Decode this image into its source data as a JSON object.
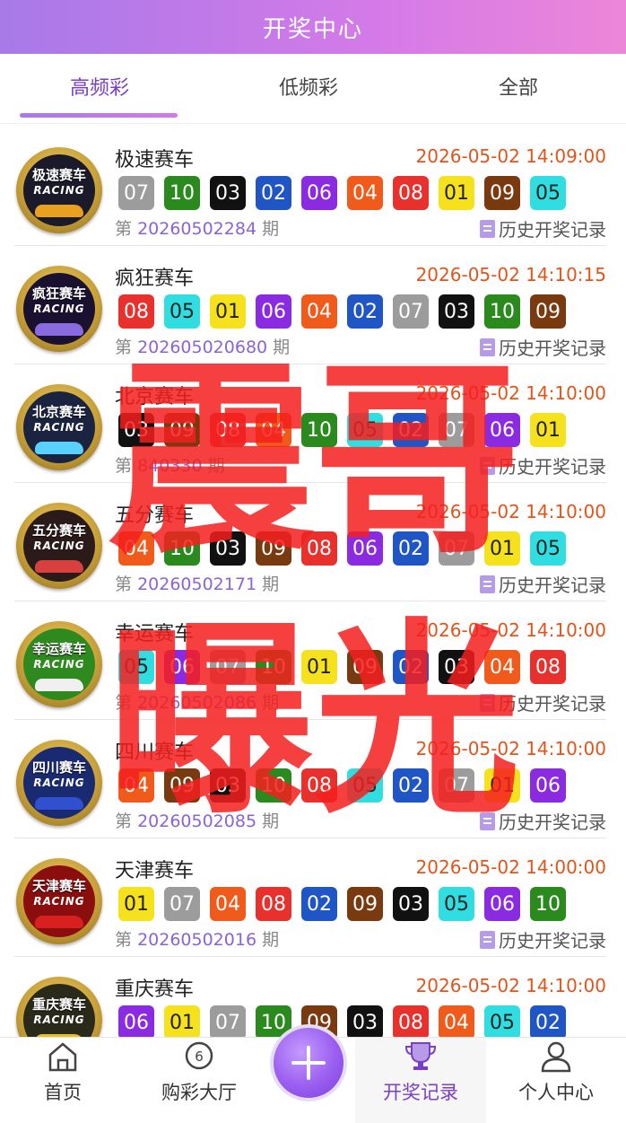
{
  "header": {
    "title": "开奖中心"
  },
  "tabs": [
    {
      "label": "高频彩",
      "active": true
    },
    {
      "label": "低频彩",
      "active": false
    },
    {
      "label": "全部",
      "active": false
    }
  ],
  "issue_prefix": "第",
  "issue_suffix": "期",
  "history_label": "历史开奖记录",
  "logo_sub": "RACING",
  "lotteries": [
    {
      "name": "极速赛车",
      "logo_name": "极速赛车",
      "time": "2026-05-02 14:09:00",
      "issue": "20260502284",
      "balls": [
        "07",
        "10",
        "03",
        "02",
        "06",
        "04",
        "08",
        "01",
        "09",
        "05"
      ]
    },
    {
      "name": "疯狂赛车",
      "logo_name": "疯狂赛车",
      "time": "2026-05-02 14:10:15",
      "issue": "202605020680",
      "balls": [
        "08",
        "05",
        "01",
        "06",
        "04",
        "02",
        "07",
        "03",
        "10",
        "09"
      ]
    },
    {
      "name": "北京赛车",
      "logo_name": "北京赛车",
      "time": "2026-05-02 14:10:00",
      "issue": "840330",
      "balls": [
        "03",
        "09",
        "08",
        "04",
        "10",
        "05",
        "02",
        "07",
        "06",
        "01"
      ]
    },
    {
      "name": "五分赛车",
      "logo_name": "五分赛车",
      "time": "2026-05-02 14:10:00",
      "issue": "20260502171",
      "balls": [
        "04",
        "10",
        "03",
        "09",
        "08",
        "06",
        "02",
        "07",
        "01",
        "05"
      ]
    },
    {
      "name": "幸运赛车",
      "logo_name": "幸运赛车",
      "time": "2026-05-02 14:10:00",
      "issue": "20260502086",
      "balls": [
        "05",
        "06",
        "07",
        "10",
        "01",
        "09",
        "02",
        "03",
        "04",
        "08"
      ]
    },
    {
      "name": "四川赛车",
      "logo_name": "四川赛车",
      "time": "2026-05-02 14:10:00",
      "issue": "20260502085",
      "balls": [
        "04",
        "09",
        "03",
        "10",
        "08",
        "05",
        "02",
        "07",
        "01",
        "06"
      ]
    },
    {
      "name": "天津赛车",
      "logo_name": "天津赛车",
      "time": "2026-05-02 14:00:00",
      "issue": "20260502016",
      "balls": [
        "01",
        "07",
        "04",
        "08",
        "02",
        "09",
        "03",
        "05",
        "06",
        "10"
      ]
    },
    {
      "name": "重庆赛车",
      "logo_name": "重庆赛车",
      "time": "2026-05-02 14:10:00",
      "issue": "",
      "balls": [
        "06",
        "01",
        "07",
        "10",
        "09",
        "03",
        "08",
        "04",
        "05",
        "02"
      ]
    }
  ],
  "ball_colors": {
    "01": "#f5e11c",
    "02": "#1f55c4",
    "03": "#111111",
    "04": "#f05a1a",
    "05": "#30dde0",
    "06": "#8a2be2",
    "07": "#9c9c9c",
    "08": "#e8302c",
    "09": "#7a3a10",
    "10": "#2a8a1e"
  },
  "watermark": [
    "震",
    "哥",
    "曝",
    "光"
  ],
  "bottom_nav": [
    {
      "label": "首页",
      "icon": "home-icon"
    },
    {
      "label": "购彩大厅",
      "icon": "lottery-ball-icon"
    },
    {
      "label": "开奖记录",
      "icon": "trophy-icon",
      "active": true
    },
    {
      "label": "个人中心",
      "icon": "user-icon"
    }
  ],
  "fab_icon": "plus-icon"
}
